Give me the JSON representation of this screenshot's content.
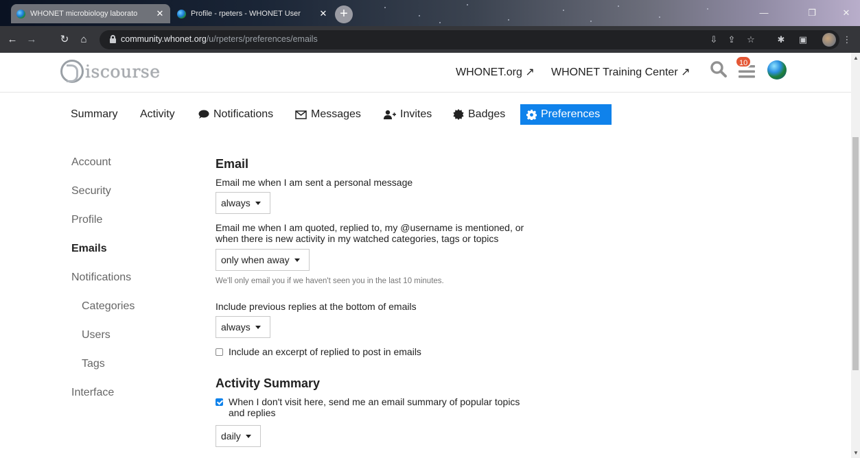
{
  "browser": {
    "tabs": [
      {
        "title": "WHONET microbiology laborato",
        "active": true
      },
      {
        "title": "Profile - rpeters - WHONET User",
        "active": false
      }
    ],
    "new_tab": "+",
    "url_domain": "community.whonet.org",
    "url_path": "/u/rpeters/preferences/emails"
  },
  "header": {
    "logo_word": "iscourse",
    "links": [
      "WHONET.org ↗",
      "WHONET Training Center ↗"
    ],
    "notification_count": "10"
  },
  "nav": {
    "items": [
      {
        "label": "Summary",
        "icon": ""
      },
      {
        "label": "Activity",
        "icon": ""
      },
      {
        "label": "Notifications",
        "icon": "comment-icon"
      },
      {
        "label": "Messages",
        "icon": "envelope-icon"
      },
      {
        "label": "Invites",
        "icon": "user-plus-icon"
      },
      {
        "label": "Badges",
        "icon": "certificate-icon"
      },
      {
        "label": "Preferences",
        "icon": "cog-icon",
        "active": true
      }
    ]
  },
  "sidebar": {
    "items": [
      {
        "label": "Account"
      },
      {
        "label": "Security"
      },
      {
        "label": "Profile"
      },
      {
        "label": "Emails",
        "active": true
      },
      {
        "label": "Notifications"
      },
      {
        "label": "Categories"
      },
      {
        "label": "Users"
      },
      {
        "label": "Tags"
      },
      {
        "label": "Interface"
      }
    ]
  },
  "main": {
    "email_heading": "Email",
    "pm_label": "Email me when I am sent a personal message",
    "pm_value": "always",
    "mention_label_1": "Email me when I am quoted, replied to, my @username is mentioned, or",
    "mention_label_2": "when there is new activity in my watched categories, tags or topics",
    "mention_value": "only when away",
    "mention_hint": "We'll only email you if we haven't seen you in the last 10 minutes.",
    "prev_replies_label": "Include previous replies at the bottom of emails",
    "prev_replies_value": "always",
    "excerpt_label": "Include an excerpt of replied to post in emails",
    "excerpt_checked": false,
    "activity_heading": "Activity Summary",
    "digest_label_1": "When I don't visit here, send me an email summary of popular topics",
    "digest_label_2": "and replies",
    "digest_checked": true,
    "digest_value": "daily"
  },
  "colors": {
    "accent": "#0f82eb",
    "badge": "#e45735"
  }
}
